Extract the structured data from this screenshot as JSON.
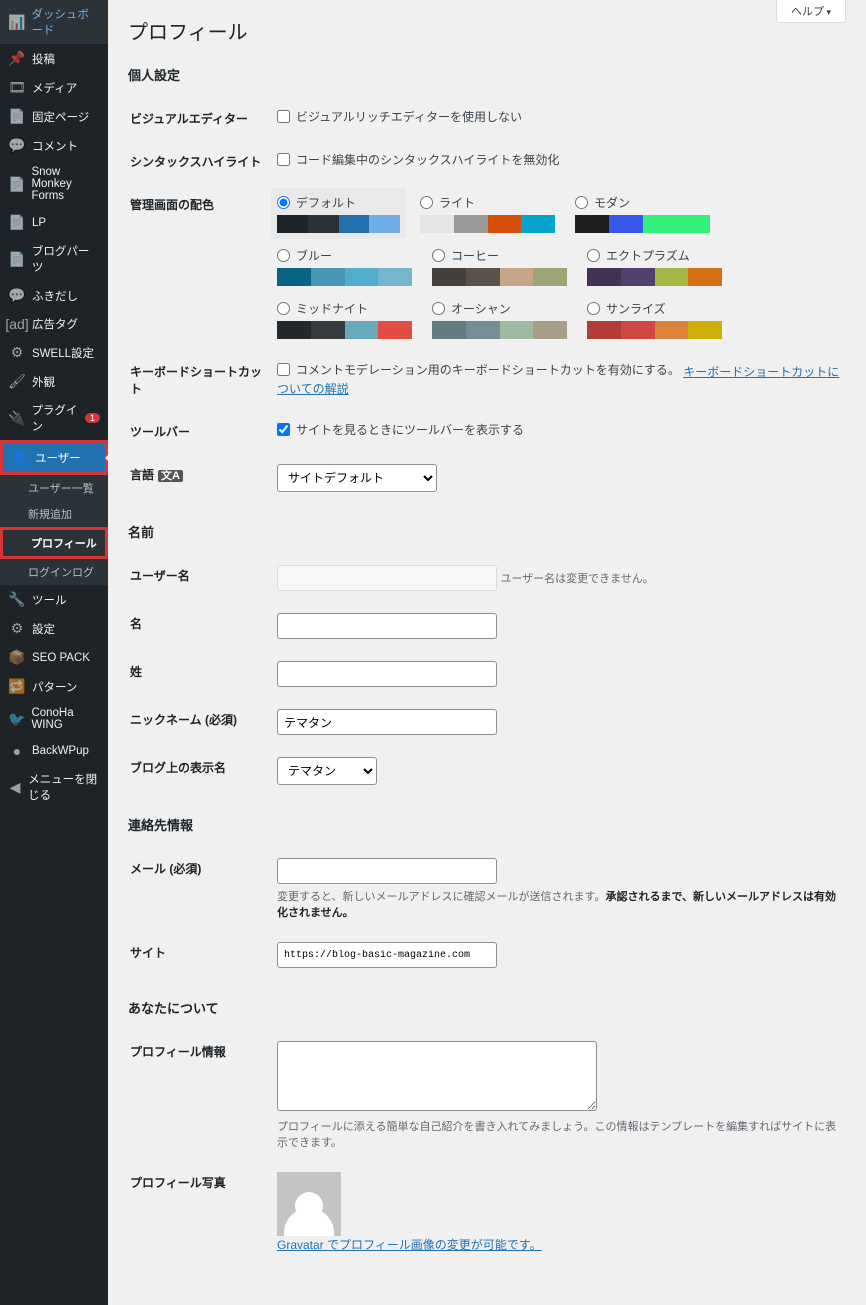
{
  "help_tab": "ヘルプ",
  "sidebar": {
    "items": [
      {
        "icon": "📊",
        "label": "ダッシュボード"
      },
      {
        "icon": "📌",
        "label": "投稿"
      },
      {
        "icon": "🎞",
        "label": "メディア"
      },
      {
        "icon": "📄",
        "label": "固定ページ"
      },
      {
        "icon": "💬",
        "label": "コメント"
      },
      {
        "icon": "📄",
        "label": "Snow Monkey Forms"
      },
      {
        "icon": "📄",
        "label": "LP"
      },
      {
        "icon": "📄",
        "label": "ブログパーツ"
      },
      {
        "icon": "💬",
        "label": "ふきだし"
      },
      {
        "icon": "[ad]",
        "label": "広告タグ"
      },
      {
        "icon": "⚙",
        "label": "SWELL設定"
      },
      {
        "icon": "🖌",
        "label": "外観"
      },
      {
        "icon": "🔌",
        "label": "プラグイン",
        "badge": "1"
      },
      {
        "icon": "👤",
        "label": "ユーザー",
        "current": true,
        "highlight": true
      }
    ],
    "submenu": [
      {
        "label": "ユーザー一覧"
      },
      {
        "label": "新規追加"
      },
      {
        "label": "プロフィール",
        "current": true,
        "highlight": true
      },
      {
        "label": "ログインログ"
      }
    ],
    "items2": [
      {
        "icon": "🔧",
        "label": "ツール"
      },
      {
        "icon": "⚙",
        "label": "設定"
      },
      {
        "icon": "📦",
        "label": "SEO PACK"
      },
      {
        "icon": "🔁",
        "label": "パターン"
      },
      {
        "icon": "🐦",
        "label": "ConoHa WING"
      },
      {
        "icon": "●",
        "label": "BackWPup"
      },
      {
        "icon": "◀",
        "label": "メニューを閉じる"
      }
    ]
  },
  "page": {
    "title": "プロフィール",
    "sections": {
      "personal": "個人設定",
      "name": "名前",
      "contact": "連絡先情報",
      "about": "あなたについて"
    },
    "rows": {
      "visual_editor": {
        "label": "ビジュアルエディター",
        "cb": "ビジュアルリッチエディターを使用しない"
      },
      "syntax": {
        "label": "シンタックスハイライト",
        "cb": "コード編集中のシンタックスハイライトを無効化"
      },
      "color_scheme": {
        "label": "管理画面の配色"
      },
      "keyboard": {
        "label": "キーボードショートカット",
        "cb": "コメントモデレーション用のキーボードショートカットを有効にする。",
        "link": "キーボードショートカットについての解説"
      },
      "toolbar": {
        "label": "ツールバー",
        "cb": "サイトを見るときにツールバーを表示する"
      },
      "language": {
        "label": "言語",
        "value": "サイトデフォルト"
      },
      "username": {
        "label": "ユーザー名",
        "desc": "ユーザー名は変更できません。"
      },
      "first_name": {
        "label": "名"
      },
      "last_name": {
        "label": "姓"
      },
      "nickname": {
        "label": "ニックネーム (必須)",
        "value": "テマタン"
      },
      "display_name": {
        "label": "ブログ上の表示名",
        "value": "テマタン"
      },
      "email": {
        "label": "メール (必須)",
        "desc_pre": "変更すると、新しいメールアドレスに確認メールが送信されます。",
        "desc_bold": "承認されるまで、新しいメールアドレスは有効化されません。"
      },
      "website": {
        "label": "サイト",
        "value": "https://blog-basic-magazine.com"
      },
      "bio": {
        "label": "プロフィール情報",
        "desc": "プロフィールに添える簡単な自己紹介を書き入れてみましょう。この情報はテンプレートを編集すればサイトに表示できます。"
      },
      "avatar": {
        "label": "プロフィール写真",
        "link": "Gravatar でプロフィール画像の変更が可能です。"
      }
    },
    "color_schemes": [
      {
        "name": "デフォルト",
        "selected": true,
        "colors": [
          "#1d2327",
          "#2c3338",
          "#2271b1",
          "#72aee6"
        ]
      },
      {
        "name": "ライト",
        "colors": [
          "#e5e5e5",
          "#999999",
          "#d64e07",
          "#04a4cc"
        ]
      },
      {
        "name": "モダン",
        "colors": [
          "#1e1e1e",
          "#3858e9",
          "#33f078",
          "#33f078"
        ]
      },
      {
        "name": "ブルー",
        "colors": [
          "#096484",
          "#4796b3",
          "#52accc",
          "#74b6ce"
        ]
      },
      {
        "name": "コーヒー",
        "colors": [
          "#46403c",
          "#59524c",
          "#c7a589",
          "#9ea476"
        ]
      },
      {
        "name": "エクトプラズム",
        "colors": [
          "#413256",
          "#523f6d",
          "#a3b745",
          "#d46f15"
        ]
      },
      {
        "name": "ミッドナイト",
        "colors": [
          "#25282b",
          "#363b3f",
          "#69a8bb",
          "#e14d43"
        ]
      },
      {
        "name": "オーシャン",
        "colors": [
          "#627c83",
          "#738e96",
          "#9ebaa0",
          "#aa9d88"
        ]
      },
      {
        "name": "サンライズ",
        "colors": [
          "#b43c38",
          "#cf4944",
          "#dd823b",
          "#ccaf0b"
        ]
      }
    ]
  }
}
